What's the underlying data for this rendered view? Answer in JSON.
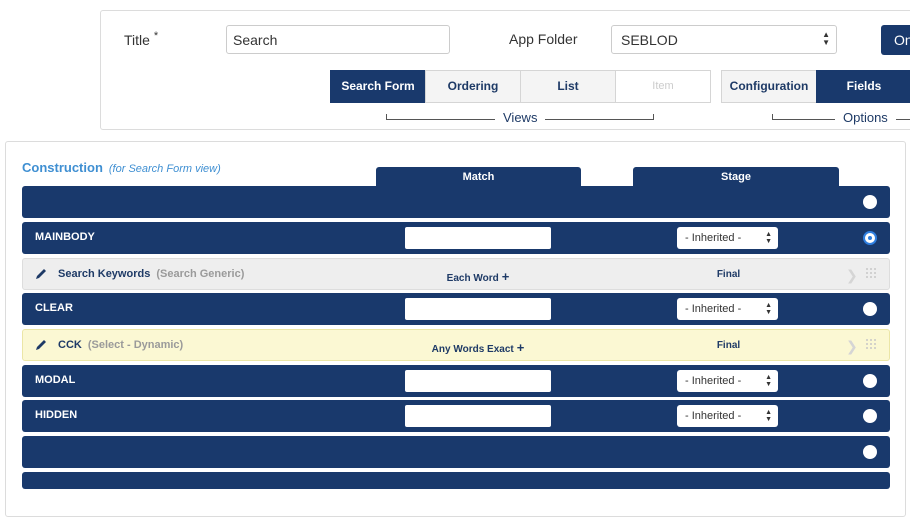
{
  "header": {
    "title_label": "Title",
    "title_required": "*",
    "title_value": "Search",
    "folder_label": "App Folder",
    "folder_value": "SEBLOD",
    "right_button_label": "On"
  },
  "tabs": {
    "views": [
      "Search Form",
      "Ordering",
      "List",
      "Item"
    ],
    "views_group_label": "Views",
    "options": [
      "Configuration",
      "Fields"
    ],
    "options_group_label": "Options"
  },
  "construction": {
    "title": "Construction",
    "subtitle": "(for Search Form view)",
    "col_match": "Match",
    "col_stage": "Stage"
  },
  "rows": [
    {
      "kind": "blue",
      "name": "",
      "stage": ""
    },
    {
      "kind": "blue",
      "name": "MAINBODY",
      "stage": "- Inherited -"
    },
    {
      "kind": "field",
      "name": "Search Keywords",
      "type": "(Search Generic)",
      "match": "Each Word",
      "stage": "Final"
    },
    {
      "kind": "blue",
      "name": "CLEAR",
      "stage": "- Inherited -"
    },
    {
      "kind": "field",
      "name": "CCK",
      "type": "(Select - Dynamic)",
      "match": "Any Words Exact",
      "stage": "Final"
    },
    {
      "kind": "blue",
      "name": "MODAL",
      "stage": "- Inherited -"
    },
    {
      "kind": "blue",
      "name": "HIDDEN",
      "stage": "- Inherited -"
    },
    {
      "kind": "blue",
      "name": "",
      "stage": ""
    }
  ],
  "colors": {
    "navy": "#19396c",
    "link_blue": "#3f8fd2",
    "highlight_yellow": "#fbf8d3",
    "radio_checked": "#2f7fe0"
  }
}
